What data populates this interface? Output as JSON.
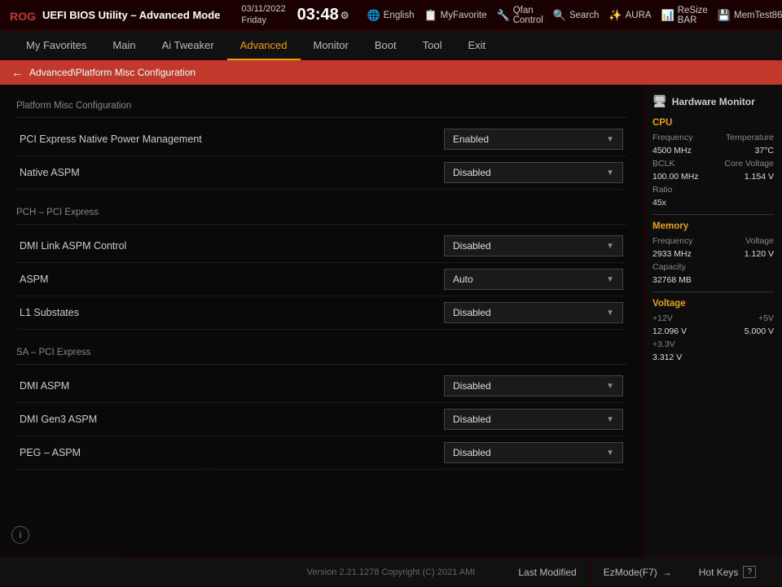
{
  "topbar": {
    "title": "UEFI BIOS Utility – Advanced Mode",
    "date": "03/11/2022",
    "day": "Friday",
    "time": "03:48",
    "nav_items": [
      {
        "label": "English",
        "icon": "🌐"
      },
      {
        "label": "MyFavorite",
        "icon": "📋"
      },
      {
        "label": "Qfan Control",
        "icon": "🔧"
      },
      {
        "label": "Search",
        "icon": "🔍"
      },
      {
        "label": "AURA",
        "icon": "✨"
      },
      {
        "label": "ReSize BAR",
        "icon": "📊"
      },
      {
        "label": "MemTest86",
        "icon": "💾"
      }
    ]
  },
  "mainnav": {
    "items": [
      {
        "label": "My Favorites",
        "active": false
      },
      {
        "label": "Main",
        "active": false
      },
      {
        "label": "Ai Tweaker",
        "active": false
      },
      {
        "label": "Advanced",
        "active": true
      },
      {
        "label": "Monitor",
        "active": false
      },
      {
        "label": "Boot",
        "active": false
      },
      {
        "label": "Tool",
        "active": false
      },
      {
        "label": "Exit",
        "active": false
      }
    ]
  },
  "breadcrumb": "Advanced\\Platform Misc Configuration",
  "sections": [
    {
      "title": "Platform Misc Configuration",
      "settings": [
        {
          "label": "PCI Express Native Power Management",
          "value": "Enabled"
        },
        {
          "label": "Native ASPM",
          "value": "Disabled"
        }
      ]
    },
    {
      "title": "PCH – PCI Express",
      "settings": [
        {
          "label": "DMI Link ASPM Control",
          "value": "Disabled"
        },
        {
          "label": "ASPM",
          "value": "Auto"
        },
        {
          "label": "L1 Substates",
          "value": "Disabled"
        }
      ]
    },
    {
      "title": "SA – PCI Express",
      "settings": [
        {
          "label": "DMI ASPM",
          "value": "Disabled"
        },
        {
          "label": "DMI Gen3 ASPM",
          "value": "Disabled"
        },
        {
          "label": "PEG – ASPM",
          "value": "Disabled"
        }
      ]
    }
  ],
  "sidebar": {
    "title": "Hardware Monitor",
    "cpu": {
      "section": "CPU",
      "frequency_label": "Frequency",
      "frequency_value": "4500 MHz",
      "temperature_label": "Temperature",
      "temperature_value": "37°C",
      "bclk_label": "BCLK",
      "bclk_value": "100.00 MHz",
      "core_voltage_label": "Core Voltage",
      "core_voltage_value": "1.154 V",
      "ratio_label": "Ratio",
      "ratio_value": "45x"
    },
    "memory": {
      "section": "Memory",
      "frequency_label": "Frequency",
      "frequency_value": "2933 MHz",
      "voltage_label": "Voltage",
      "voltage_value": "1.120 V",
      "capacity_label": "Capacity",
      "capacity_value": "32768 MB"
    },
    "voltage": {
      "section": "Voltage",
      "v12_label": "+12V",
      "v12_value": "12.096 V",
      "v5_label": "+5V",
      "v5_value": "5.000 V",
      "v33_label": "+3.3V",
      "v33_value": "3.312 V"
    }
  },
  "bottom": {
    "version": "Version 2.21.1278 Copyright (C) 2021 AMI",
    "last_modified": "Last Modified",
    "ez_mode": "EzMode(F7)",
    "hot_keys": "Hot Keys"
  }
}
